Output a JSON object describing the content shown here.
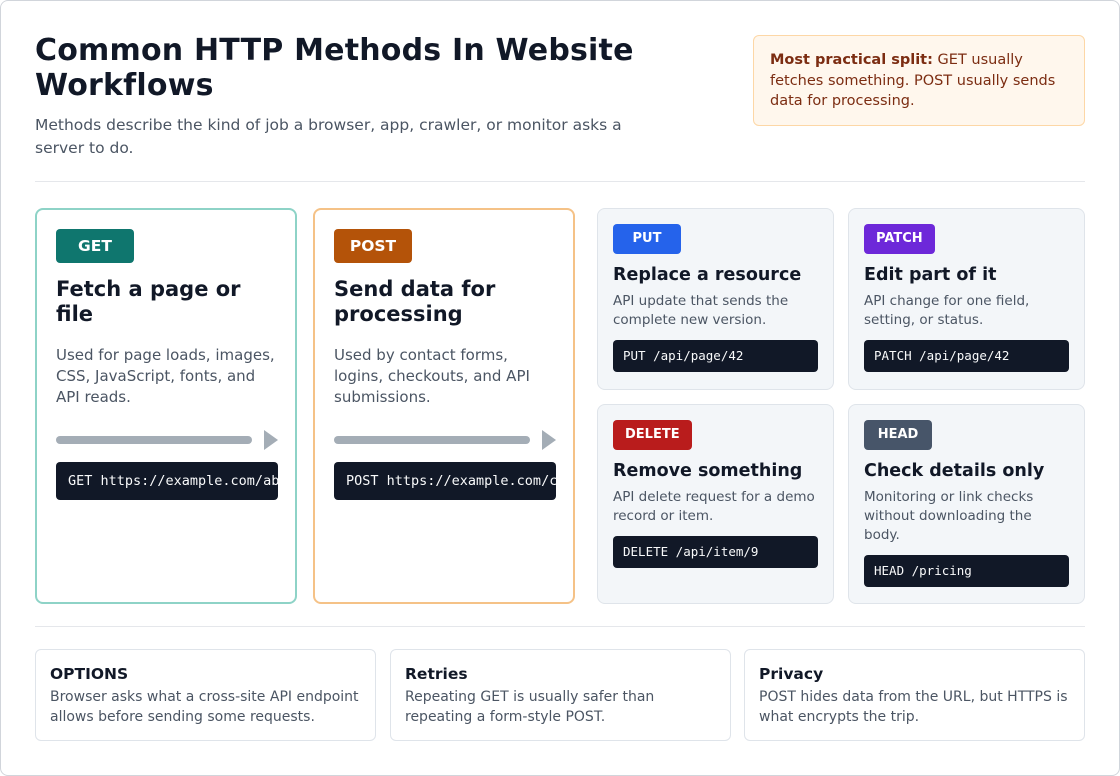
{
  "header": {
    "title": "Common HTTP Methods In Website Workflows",
    "subtitle": "Methods describe the kind of job a browser, app, crawler, or monitor asks a server to do.",
    "callout_bold": "Most practical split:",
    "callout_text": " GET usually fetches something. POST usually sends data for processing."
  },
  "primary_methods": [
    {
      "method": "GET",
      "color": "#0f766e",
      "title": "Fetch a page or file",
      "description": "Used for page loads, images, CSS, JavaScript, fonts, and API reads.",
      "example": "GET https://example.com/about"
    },
    {
      "method": "POST",
      "color": "#b45309",
      "title": "Send data for processing",
      "description": "Used by contact forms, logins, checkouts, and API submissions.",
      "example": "POST https://example.com/contact"
    }
  ],
  "other_methods": [
    {
      "method": "PUT",
      "color": "#2563eb",
      "title": "Replace a resource",
      "description": "API update that sends the complete new version.",
      "example": "PUT /api/page/42"
    },
    {
      "method": "PATCH",
      "color": "#6d28d9",
      "title": "Edit part of it",
      "description": "API change for one field, setting, or status.",
      "example": "PATCH /api/page/42"
    },
    {
      "method": "DELETE",
      "color": "#b91c1c",
      "title": "Remove something",
      "description": "API delete request for a demo record or item.",
      "example": "DELETE /api/item/9"
    },
    {
      "method": "HEAD",
      "color": "#475569",
      "title": "Check details only",
      "description": "Monitoring or link checks without downloading the body.",
      "example": "HEAD /pricing"
    }
  ],
  "notes": [
    {
      "title": "OPTIONS",
      "text": "Browser asks what a cross-site API endpoint allows before sending some requests."
    },
    {
      "title": "Retries",
      "text": "Repeating GET is usually safer than repeating a form-style POST."
    },
    {
      "title": "Privacy",
      "text": "POST hides data from the URL, but HTTPS is what encrypts the trip."
    }
  ]
}
